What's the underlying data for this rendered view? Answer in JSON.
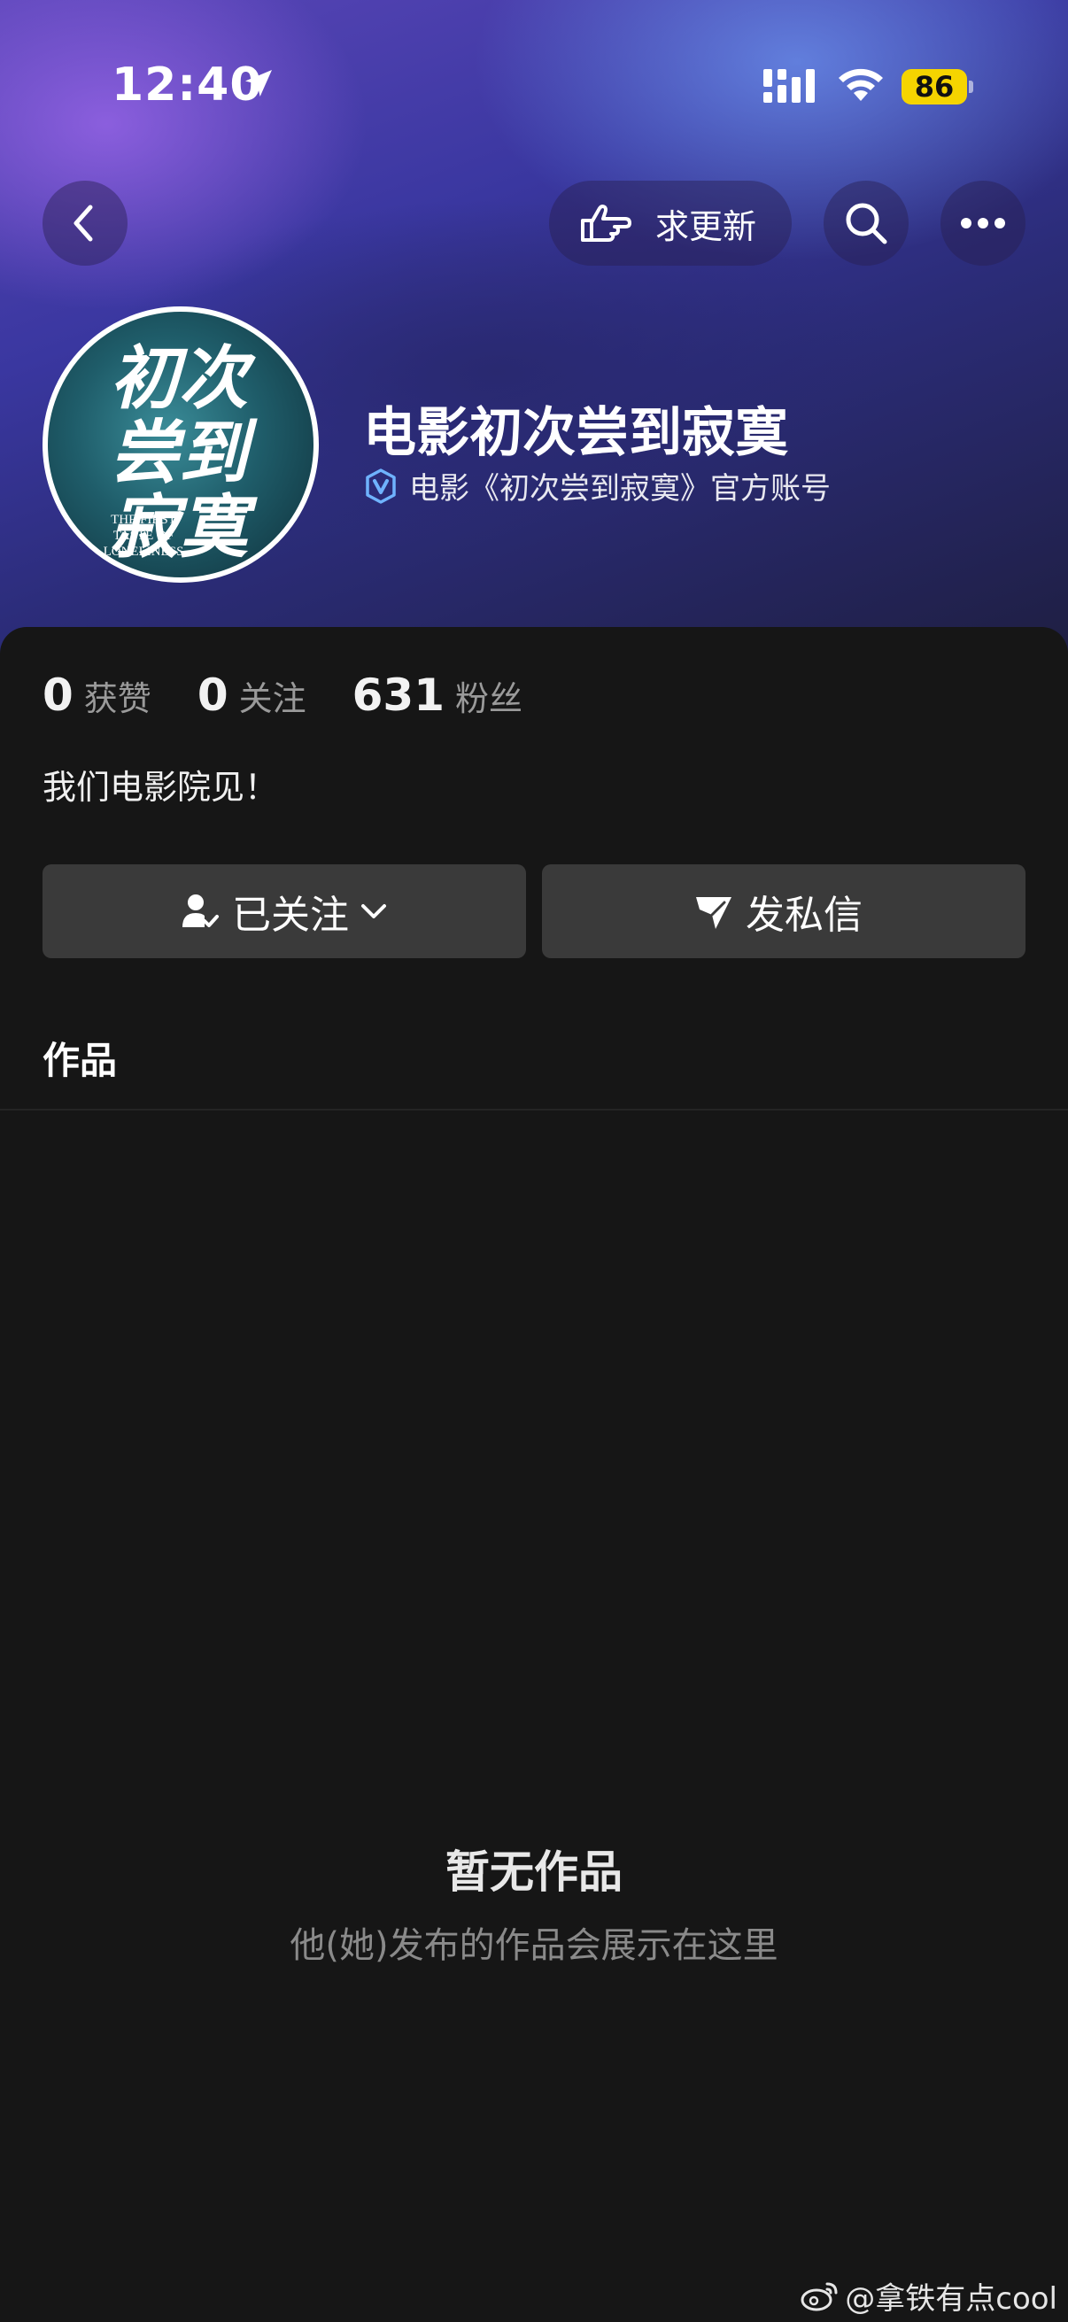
{
  "status_bar": {
    "time": "12:40",
    "battery": "86"
  },
  "nav": {
    "update_label": "求更新"
  },
  "profile": {
    "name": "电影初次尝到寂寞",
    "verified_text": "电影《初次尝到寂寞》官方账号",
    "avatar_title": "初次尝到寂寞",
    "avatar_subtitle": "THE FIRST TASTE OF LONELINESS",
    "bio": "我们电影院见！"
  },
  "stats": [
    {
      "value": "0",
      "label": "获赞"
    },
    {
      "value": "0",
      "label": "关注"
    },
    {
      "value": "631",
      "label": "粉丝"
    }
  ],
  "actions": {
    "follow_label": "已关注",
    "message_label": "发私信"
  },
  "tabs": {
    "works": "作品"
  },
  "empty": {
    "title": "暂无作品",
    "subtitle": "他(她)发布的作品会展示在这里"
  },
  "watermark": {
    "text": "@拿铁有点cool"
  },
  "colors": {
    "battery": "#f5d400",
    "background": "#161616",
    "button": "#3a3a3a",
    "verify": "#6fb3ff"
  }
}
